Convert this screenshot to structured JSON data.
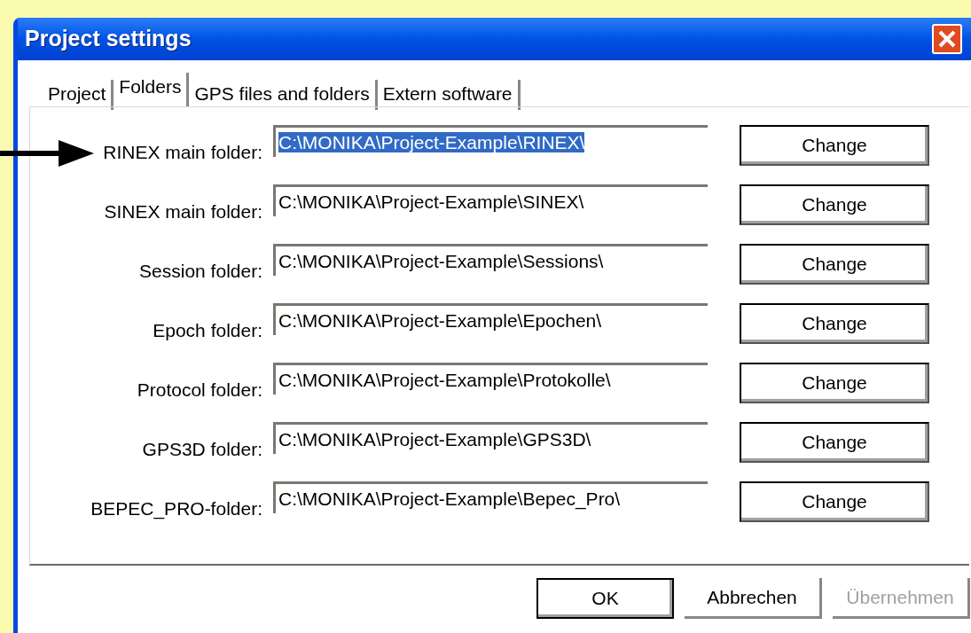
{
  "window": {
    "title": "Project settings"
  },
  "tabs": [
    {
      "label": "Project",
      "selected": false
    },
    {
      "label": "Folders",
      "selected": true
    },
    {
      "label": "GPS files and folders",
      "selected": false
    },
    {
      "label": "Extern software",
      "selected": false
    }
  ],
  "folders": [
    {
      "label": "RINEX main folder:",
      "value": "C:\\MONIKA\\Project-Example\\RINEX\\",
      "highlighted": true,
      "button": "Change"
    },
    {
      "label": "SINEX main folder:",
      "value": "C:\\MONIKA\\Project-Example\\SINEX\\",
      "highlighted": false,
      "button": "Change"
    },
    {
      "label": "Session folder:",
      "value": "C:\\MONIKA\\Project-Example\\Sessions\\",
      "highlighted": false,
      "button": "Change"
    },
    {
      "label": "Epoch folder:",
      "value": "C:\\MONIKA\\Project-Example\\Epochen\\",
      "highlighted": false,
      "button": "Change"
    },
    {
      "label": "Protocol folder:",
      "value": "C:\\MONIKA\\Project-Example\\Protokolle\\",
      "highlighted": false,
      "button": "Change"
    },
    {
      "label": "GPS3D folder:",
      "value": "C:\\MONIKA\\Project-Example\\GPS3D\\",
      "highlighted": false,
      "button": "Change"
    },
    {
      "label": "BEPEC_PRO-folder:",
      "value": "C:\\MONIKA\\Project-Example\\Bepec_Pro\\",
      "highlighted": false,
      "button": "Change"
    }
  ],
  "buttons": [
    {
      "label": "OK",
      "default": true,
      "disabled": false
    },
    {
      "label": "Abbrechen",
      "default": false,
      "disabled": false
    },
    {
      "label": "Übernehmen",
      "default": false,
      "disabled": true
    }
  ]
}
